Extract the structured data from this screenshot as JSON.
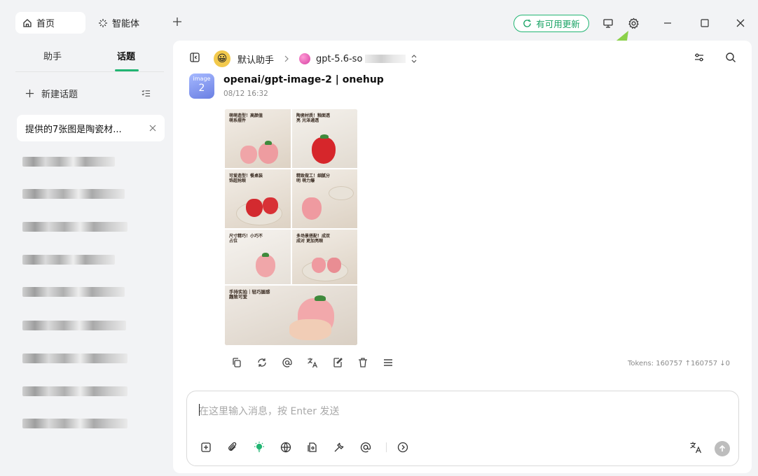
{
  "titlebar": {
    "tabs": [
      {
        "label": "首页",
        "icon": "home-icon",
        "active": true
      },
      {
        "label": "智能体",
        "icon": "sparkle-icon",
        "active": false
      }
    ],
    "add_tab_icon": "plus-icon",
    "update_label": "有可用更新",
    "accent_color": "#22b573"
  },
  "sidebar": {
    "tabs": [
      "助手",
      "话题"
    ],
    "active_tab": "话题",
    "new_topic_label": "新建话题",
    "active_topic": "提供的7张图是陶瓷材..."
  },
  "chat": {
    "assistant_name": "默认助手",
    "assistant_emoji": "😀",
    "model_label": "gpt-5.6-so",
    "message": {
      "avatar_text_top": "image",
      "avatar_text_bottom": "2",
      "model_name": "openai/gpt-image-2 | onehup",
      "time": "08/12 16:32"
    },
    "image_captions": [
      "萌萌造型！高颜值萌系摆件",
      "陶瓷材质！釉面透亮 光泽通透",
      "可爱造型！餐桌装饰超抢眼",
      "精致做工！细腻分明 萌力爆",
      "尺寸精巧！小巧不占位",
      "多场景搭配！成双成对 更加亮眼",
      "手持实拍｜轻巧握感 趣致可爱"
    ],
    "tokens": "Tokens: 160757 ↑160757 ↓0"
  },
  "input": {
    "placeholder": "在这里输入消息，按 Enter 发送"
  }
}
